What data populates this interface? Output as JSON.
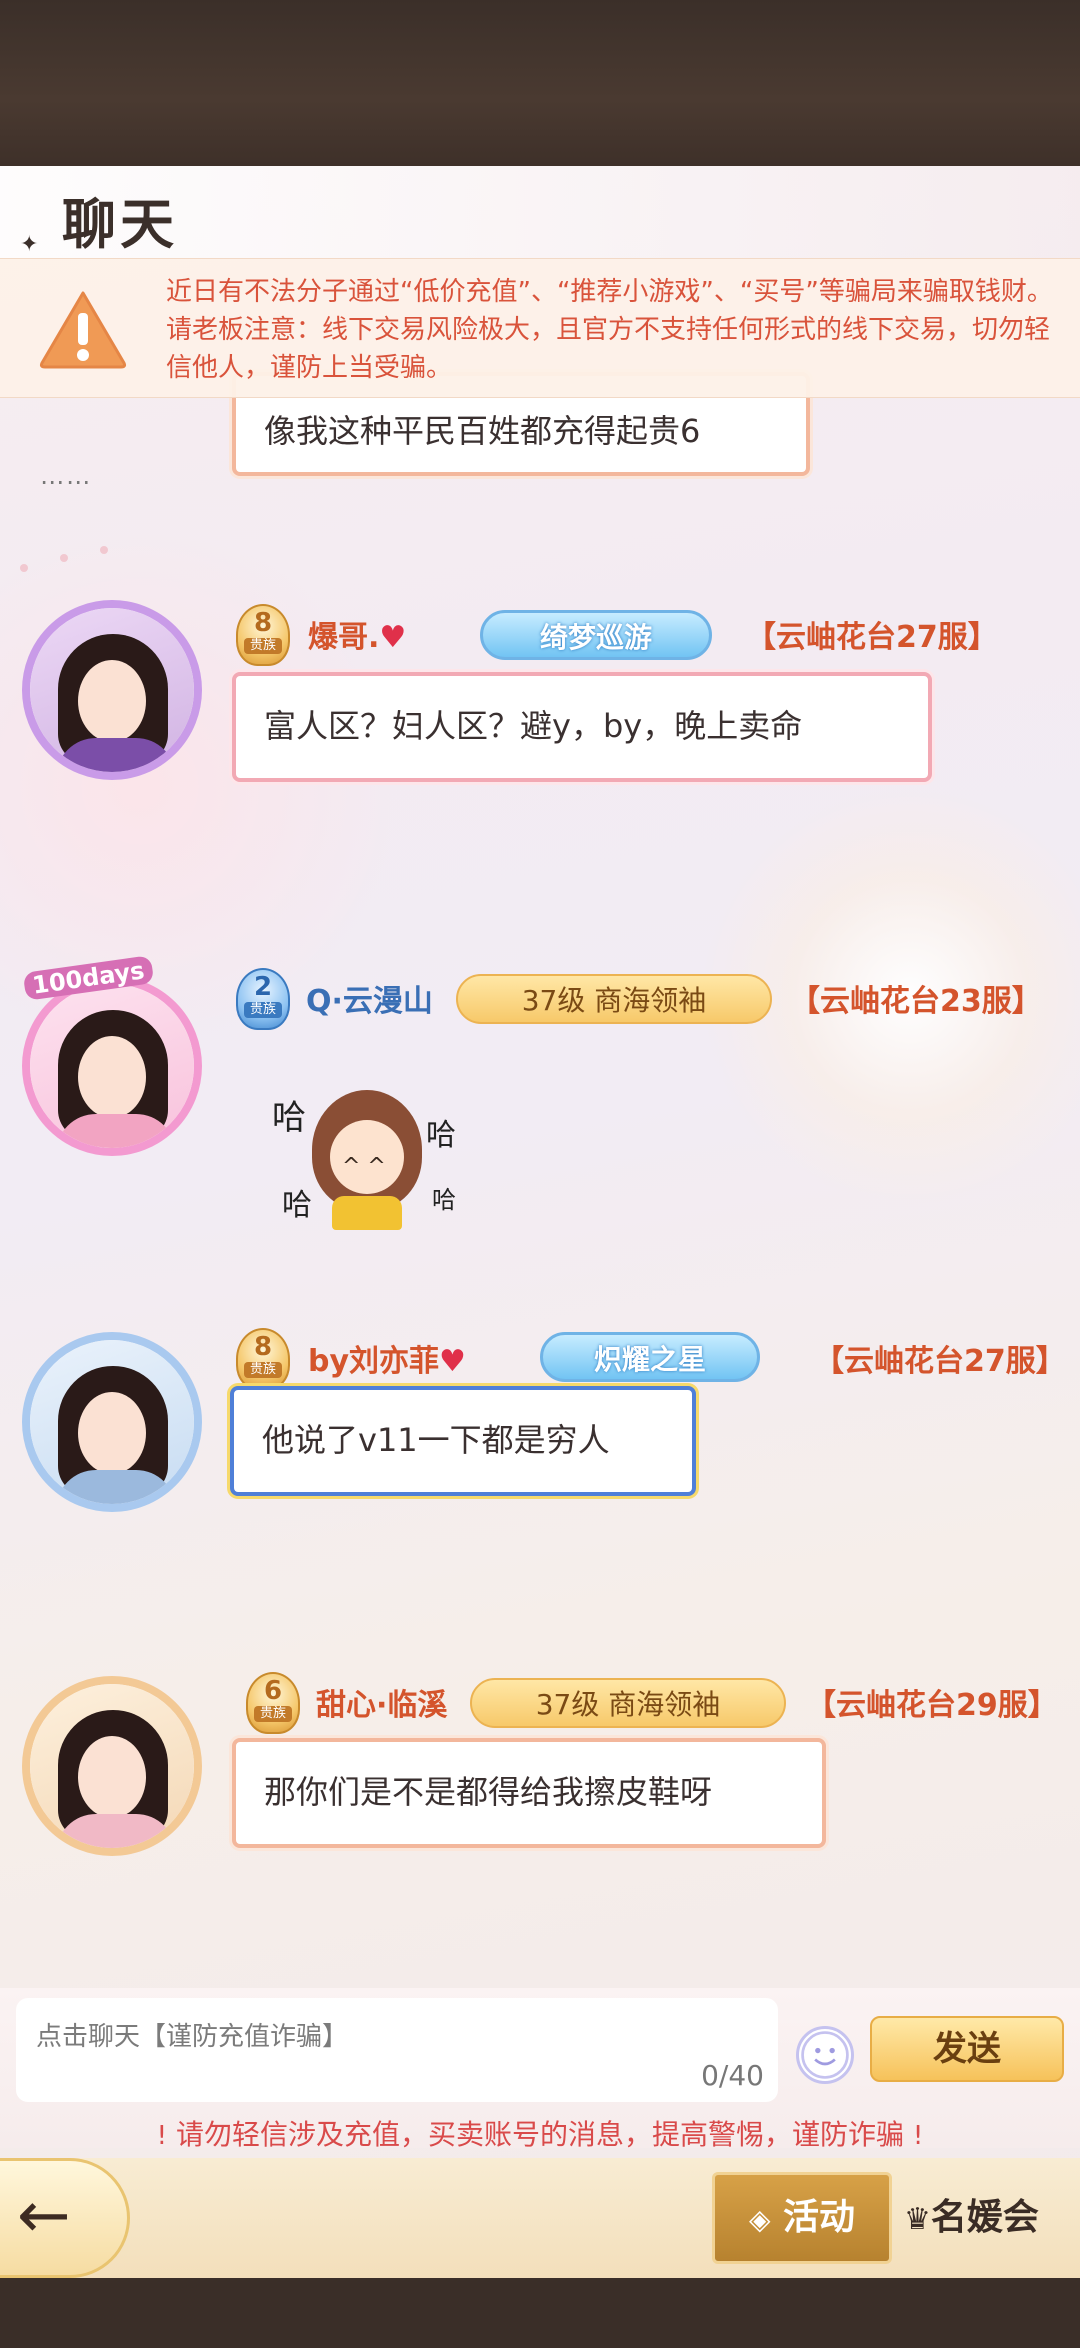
{
  "header": {
    "title": "聊天"
  },
  "warning": {
    "text": "近日有不法分子通过“低价充值”、“推荐小游戏”、“买号”等骗局来骗取钱财。请老板注意：线下交易风险极大，且官方不支持任何形式的线下交易，切勿轻信他人，谨防上当受骗。"
  },
  "partial_message": {
    "text": "像我这种平民百姓都充得起贵6",
    "dots": "⋯⋯"
  },
  "messages": [
    {
      "level": "8",
      "level_label": "贵族",
      "name": "爆哥.",
      "name_suffix": "♥",
      "title": "绮梦巡游",
      "server": "【云岫花台27服】",
      "text": "富人区？妇人区？避y，by，晚上卖命"
    },
    {
      "level": "2",
      "level_label": "贵族",
      "name": "Q·云漫山",
      "title": "37级 商海领袖",
      "server": "【云岫花台23服】",
      "avatar_badge": "100days",
      "sticker_text": [
        "哈",
        "哈",
        "哈",
        "哈"
      ]
    },
    {
      "level": "8",
      "level_label": "贵族",
      "name": "by刘亦菲",
      "name_suffix": "♥",
      "title": "炽耀之星",
      "server": "【云岫花台27服】",
      "text": "他说了v11一下都是穷人"
    },
    {
      "level": "6",
      "level_label": "贵族",
      "name": "甜心·临溪",
      "title": "37级 商海领袖",
      "server": "【云岫花台29服】",
      "text": "那你们是不是都得给我擦皮鞋呀"
    }
  ],
  "input": {
    "placeholder": "点击聊天【谨防充值诈骗】",
    "count": "0/40",
    "send_label": "发送"
  },
  "notice": {
    "text": "请勿轻信涉及充值，买卖账号的消息，提高警惕，谨防诈骗",
    "icon": "!"
  },
  "bottom": {
    "back_icon": "←",
    "activity_label": "活动",
    "club_label": "名媛会"
  },
  "colors": {
    "accent": "#d4542c",
    "warning": "#d9533b",
    "gold": "#f6c25a"
  }
}
